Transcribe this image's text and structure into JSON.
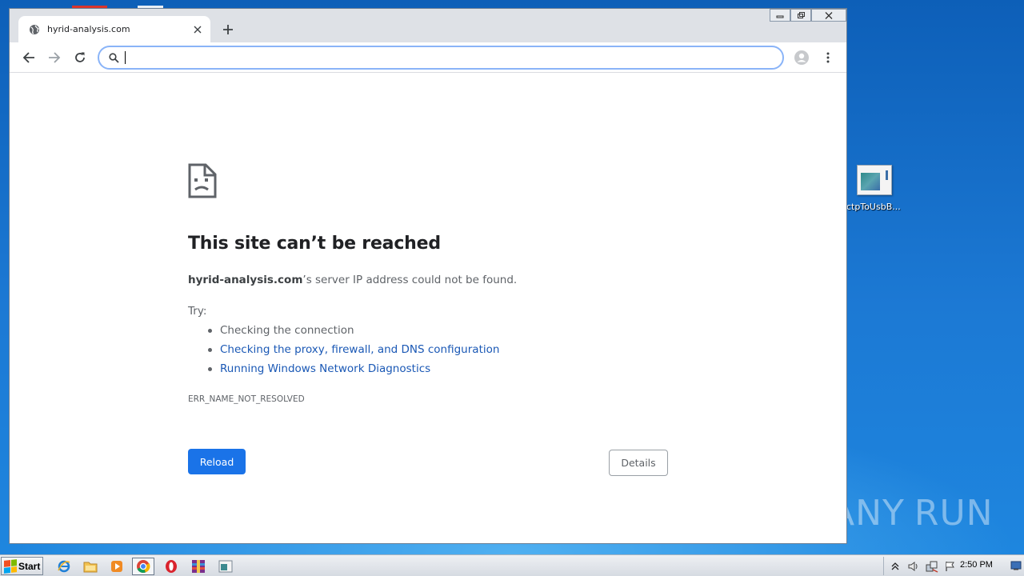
{
  "browser": {
    "tab": {
      "title": "hyrid-analysis.com",
      "favicon": "globe-icon",
      "close_icon": "close-icon"
    },
    "new_tab_icon": "plus-icon",
    "window_controls": [
      "minimize-icon",
      "restore-icon",
      "close-icon"
    ],
    "nav": {
      "back_icon": "back-arrow-icon",
      "forward_icon": "forward-arrow-icon",
      "reload_icon": "reload-icon"
    },
    "omnibox": {
      "value": "",
      "search_icon": "search-icon"
    },
    "profile_icon": "account-icon",
    "menu_icon": "kebab-menu-icon"
  },
  "error_page": {
    "icon": "sad-document-icon",
    "title": "This site can’t be reached",
    "host": "hyrid-analysis.com",
    "message_suffix": "’s server IP address could not be found.",
    "try_label": "Try:",
    "suggestions": [
      {
        "text": "Checking the connection",
        "link": false
      },
      {
        "text": "Checking the proxy, firewall, and DNS configuration",
        "link": true
      },
      {
        "text": "Running Windows Network Diagnostics",
        "link": true
      }
    ],
    "error_code": "ERR_NAME_NOT_RESOLVED",
    "reload_label": "Reload",
    "details_label": "Details"
  },
  "desktop": {
    "icon_label": "ctpToUsbB...",
    "watermark": {
      "left": "ANY",
      "right": "RUN"
    }
  },
  "taskbar": {
    "start_label": "Start",
    "items": [
      "ie-icon",
      "explorer-folder-icon",
      "media-player-icon",
      "chrome-icon",
      "opera-icon",
      "winrar-icon",
      "window-app-icon"
    ],
    "tray_icons": [
      "show-hidden-icons-arrow",
      "volume-icon",
      "network-icon",
      "action-center-flag-icon"
    ],
    "clock": "2:50 PM"
  },
  "colors": {
    "accent": "#1a73e8",
    "link": "#1a58b5",
    "text_primary": "#202124",
    "text_secondary": "#5f6368",
    "titlebar": "#dee1e6",
    "desktop": "#1565c8"
  }
}
